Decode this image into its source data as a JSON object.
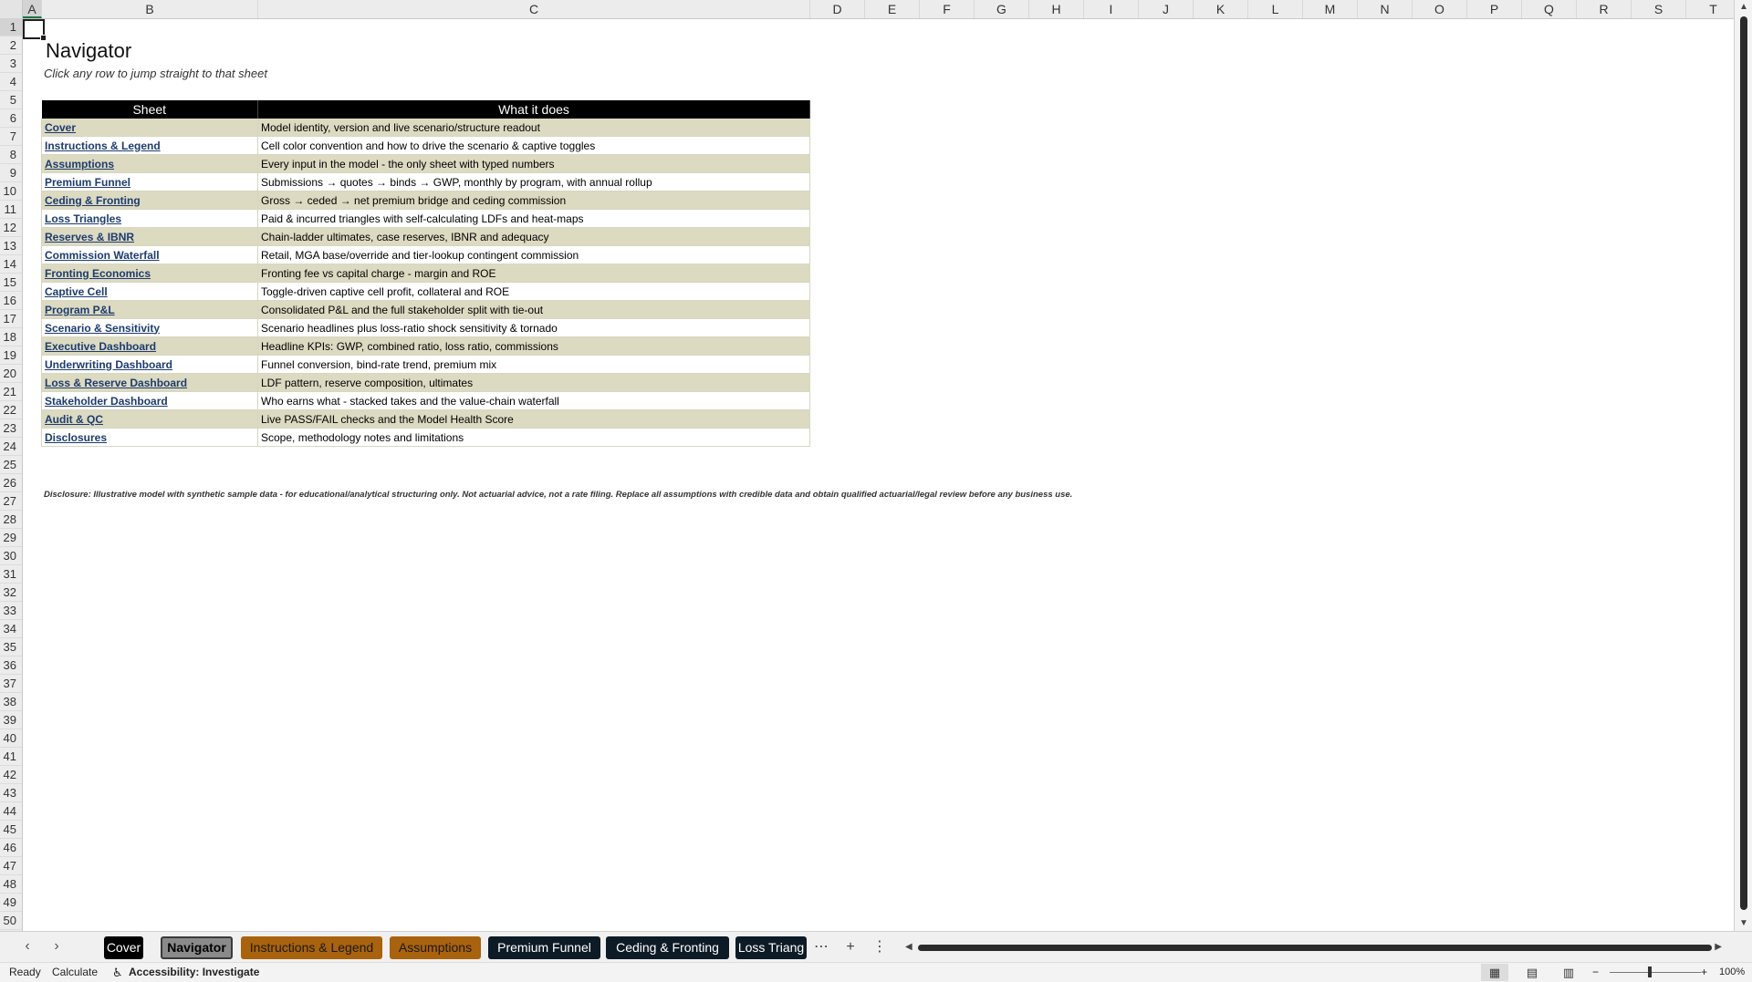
{
  "columns": [
    "A",
    "B",
    "C",
    "D",
    "E",
    "F",
    "G",
    "H",
    "I",
    "J",
    "K",
    "L",
    "M",
    "N",
    "O",
    "P",
    "Q",
    "R",
    "S",
    "T"
  ],
  "rows": [
    "1",
    "2",
    "3",
    "4",
    "5",
    "6",
    "7",
    "8",
    "9",
    "10",
    "11",
    "12",
    "13",
    "14",
    "15",
    "16",
    "17",
    "18",
    "19",
    "20",
    "21",
    "22",
    "23",
    "24",
    "25",
    "26",
    "27",
    "28",
    "29",
    "30",
    "31",
    "32",
    "33",
    "34",
    "35",
    "36",
    "37",
    "38",
    "39",
    "40",
    "41",
    "42",
    "43",
    "44",
    "45",
    "46",
    "47",
    "48",
    "49",
    "50"
  ],
  "page": {
    "title": "Navigator",
    "subtitle": "Click any row to jump straight to that sheet",
    "disclosure": "Disclosure: Illustrative model with synthetic sample data - for educational/analytical structuring only. Not actuarial advice, not a rate filing. Replace all assumptions with credible data and obtain qualified actuarial/legal review before any business use."
  },
  "table": {
    "headers": [
      "Sheet",
      "What it does"
    ],
    "rows": [
      {
        "sheet": "Cover",
        "desc": "Model identity, version and live scenario/structure readout"
      },
      {
        "sheet": "Instructions & Legend",
        "desc": "Cell color convention and how to drive the scenario & captive toggles"
      },
      {
        "sheet": "Assumptions",
        "desc": "Every input in the model - the only sheet with typed numbers"
      },
      {
        "sheet": "Premium Funnel",
        "desc": "Submissions → quotes → binds → GWP, monthly by program, with annual rollup"
      },
      {
        "sheet": "Ceding & Fronting",
        "desc": "Gross → ceded → net premium bridge and ceding commission"
      },
      {
        "sheet": "Loss Triangles",
        "desc": "Paid & incurred triangles with self-calculating LDFs and heat-maps"
      },
      {
        "sheet": "Reserves & IBNR",
        "desc": "Chain-ladder ultimates, case reserves, IBNR and adequacy"
      },
      {
        "sheet": "Commission Waterfall",
        "desc": "Retail, MGA base/override and tier-lookup contingent commission"
      },
      {
        "sheet": "Fronting Economics",
        "desc": "Fronting fee vs capital charge - margin and ROE"
      },
      {
        "sheet": "Captive Cell",
        "desc": "Toggle-driven captive cell profit, collateral and ROE"
      },
      {
        "sheet": "Program P&L",
        "desc": "Consolidated P&L and the full stakeholder split with tie-out"
      },
      {
        "sheet": "Scenario & Sensitivity",
        "desc": "Scenario headlines plus loss-ratio shock sensitivity & tornado"
      },
      {
        "sheet": "Executive Dashboard",
        "desc": "Headline KPIs: GWP, combined ratio, loss ratio, commissions"
      },
      {
        "sheet": "Underwriting Dashboard",
        "desc": "Funnel conversion, bind-rate trend, premium mix"
      },
      {
        "sheet": "Loss & Reserve Dashboard",
        "desc": "LDF pattern, reserve composition, ultimates"
      },
      {
        "sheet": "Stakeholder Dashboard",
        "desc": "Who earns what - stacked takes and the value-chain waterfall"
      },
      {
        "sheet": "Audit & QC",
        "desc": "Live PASS/FAIL checks and the Model Health Score"
      },
      {
        "sheet": "Disclosures",
        "desc": "Scope, methodology notes and limitations"
      }
    ]
  },
  "tabs": [
    {
      "label": "Cover",
      "style": "black"
    },
    {
      "label": "Navigator",
      "style": "active"
    },
    {
      "label": "Instructions & Legend",
      "style": "orange"
    },
    {
      "label": "Assumptions",
      "style": "orange"
    },
    {
      "label": "Premium Funnel",
      "style": "dark"
    },
    {
      "label": "Ceding & Fronting",
      "style": "dark"
    },
    {
      "label": "Loss Triang",
      "style": "dark"
    }
  ],
  "statusbar": {
    "ready": "Ready",
    "calculate": "Calculate",
    "accessibility": "Accessibility: Investigate",
    "zoom": "100%"
  },
  "icons": {
    "prev_sheet": "chevron-left-icon",
    "next_sheet": "chevron-right-icon",
    "more_tabs": "ellipsis-icon",
    "add_sheet": "plus-icon",
    "options": "vertical-dots-icon"
  },
  "colors": {
    "header_bg": "#000000",
    "band_row": "#dddac2",
    "link": "#1d3c6e",
    "tab_orange": "#a9620d",
    "tab_dark": "#0d1b26"
  }
}
